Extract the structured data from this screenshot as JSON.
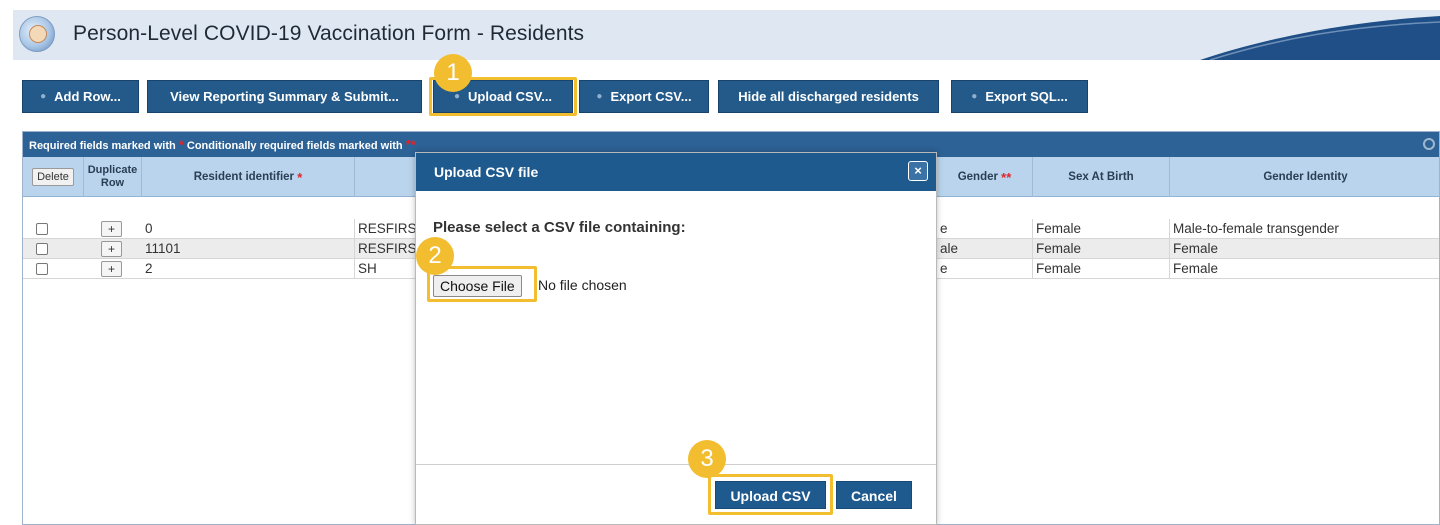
{
  "header": {
    "title": "Person-Level COVID-19 Vaccination Form - Residents"
  },
  "toolbar": {
    "add_row": "Add Row...",
    "view_summary": "View Reporting Summary & Submit...",
    "upload_csv": "Upload CSV...",
    "export_csv": "Export CSV...",
    "hide_discharged": "Hide all discharged residents",
    "export_sql": "Export SQL..."
  },
  "callouts": [
    "1",
    "2",
    "3"
  ],
  "grid": {
    "banner_required": "Required fields marked with",
    "banner_conditional": "Conditionally required fields marked with",
    "star_single": "*",
    "star_double": "**",
    "columns": {
      "delete": "Delete",
      "duplicate": "Duplicate Row",
      "resident_identifier": "Resident identifier",
      "gender": "Gender",
      "sex_at_birth": "Sex At Birth",
      "gender_identity": "Gender Identity"
    },
    "plus_label": "+",
    "rows": [
      {
        "id": "0",
        "name_partial": "RESFIRS",
        "gender_partial": "e",
        "sex_at_birth": "Female",
        "gender_identity": "Male-to-female transgender"
      },
      {
        "id": "11101",
        "name_partial": "RESFIRS",
        "gender_partial": "ale",
        "sex_at_birth": "Female",
        "gender_identity": "Female"
      },
      {
        "id": "2",
        "name_partial": "SH",
        "gender_partial": "e",
        "sex_at_birth": "Female",
        "gender_identity": "Female"
      }
    ]
  },
  "modal": {
    "title": "Upload CSV file",
    "close_symbol": "×",
    "message": "Please select a CSV file containing:",
    "choose_file": "Choose File",
    "no_file": "No file chosen",
    "upload_button": "Upload CSV",
    "cancel_button": "Cancel"
  },
  "colors": {
    "primary_blue": "#235a8a",
    "highlight": "#f2bd2f",
    "required_star": "#e0242a"
  }
}
